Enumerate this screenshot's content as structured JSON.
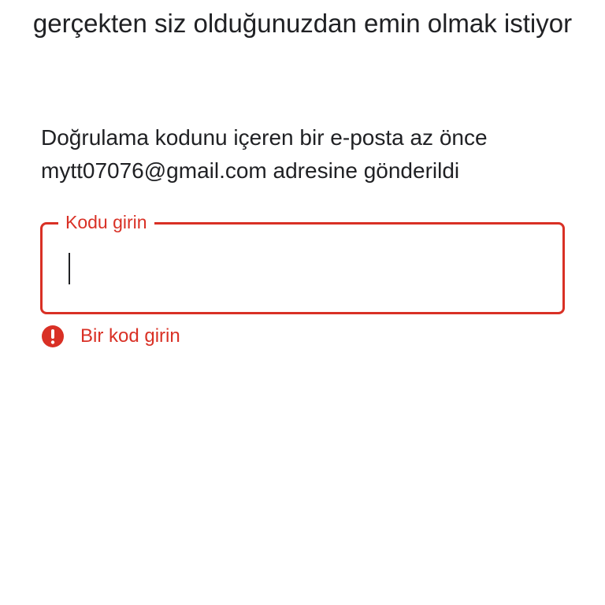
{
  "header": {
    "title": "gerçekten siz olduğunuzdan emin olmak istiyor"
  },
  "body": {
    "description": "Doğrulama kodunu içeren bir e-posta az önce mytt07076@gmail.com adresine gönderildi"
  },
  "code_field": {
    "label": "Kodu girin",
    "value": "",
    "error_message": "Bir kod girin"
  },
  "colors": {
    "error": "#d93025",
    "text": "#202124",
    "background": "#ffffff"
  },
  "icons": {
    "error": "error-icon"
  }
}
